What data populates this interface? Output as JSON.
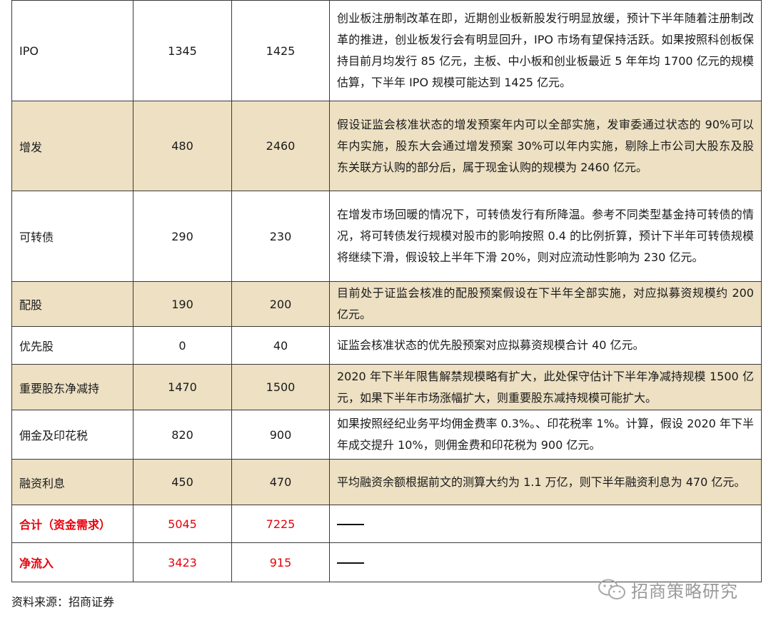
{
  "rows": [
    {
      "item": "IPO",
      "h1": "1345",
      "h2": "1425",
      "desc": "创业板注册制改革在即，近期创业板新股发行明显放缓，预计下半年随着注册制改革的推进，创业板发行会有明显回升，IPO 市场有望保持活跃。如果按照科创板保持目前月均发行 85 亿元，主板、中小板和创业板最近 5 年年均 1700 亿元的规模估算，下半年 IPO 规模可能达到 1425 亿元。"
    },
    {
      "item": "增发",
      "h1": "480",
      "h2": "2460",
      "desc": "假设证监会核准状态的增发预案年内可以全部实施，发审委通过状态的 90%可以年内实施，股东大会通过增发预案 30%可以年内实施，剔除上市公司大股东及股东关联方认购的部分后，属于现金认购的规模为 2460 亿元。"
    },
    {
      "item": "可转债",
      "h1": "290",
      "h2": "230",
      "desc": "在增发市场回暖的情况下，可转债发行有所降温。参考不同类型基金持可转债的情况，将可转债发行规模对股市的影响按照 0.4 的比例折算，预计下半年可转债规模将继续下滑，假设较上半年下滑 20%，则对应流动性影响为 230 亿元。"
    },
    {
      "item": "配股",
      "h1": "190",
      "h2": "200",
      "desc": "目前处于证监会核准的配股预案假设在下半年全部实施，对应拟募资规模约 200 亿元。"
    },
    {
      "item": "优先股",
      "h1": "0",
      "h2": "40",
      "desc": "证监会核准状态的优先股预案对应拟募资规模合计 40 亿元。"
    },
    {
      "item": "重要股东净减持",
      "h1": "1470",
      "h2": "1500",
      "desc": "2020 年下半年限售解禁规模略有扩大，此处保守估计下半年净减持规模 1500 亿元，如果下半年市场涨幅扩大，则重要股东减持规模可能扩大。"
    },
    {
      "item": "佣金及印花税",
      "h1": "820",
      "h2": "900",
      "desc": "如果按照经纪业务平均佣金费率 0.3%。、印花税率 1%。计算，假设 2020 年下半年成交提升 10%，则佣金费和印花税为 900 亿元。"
    },
    {
      "item": "融资利息",
      "h1": "450",
      "h2": "470",
      "desc": "平均融资余额根据前文的测算大约为 1.1 万亿，则下半年融资利息为 470 亿元。"
    }
  ],
  "totals": [
    {
      "item": "合计（资金需求）",
      "h1": "5045",
      "h2": "7225",
      "desc": "——"
    },
    {
      "item": "净流入",
      "h1": "3423",
      "h2": "915",
      "desc": "——"
    }
  ],
  "source": "资料来源：招商证券",
  "watermark": "招商策略研究",
  "colors": {
    "shade": "#ede0c3",
    "total_text": "#e8000b"
  }
}
